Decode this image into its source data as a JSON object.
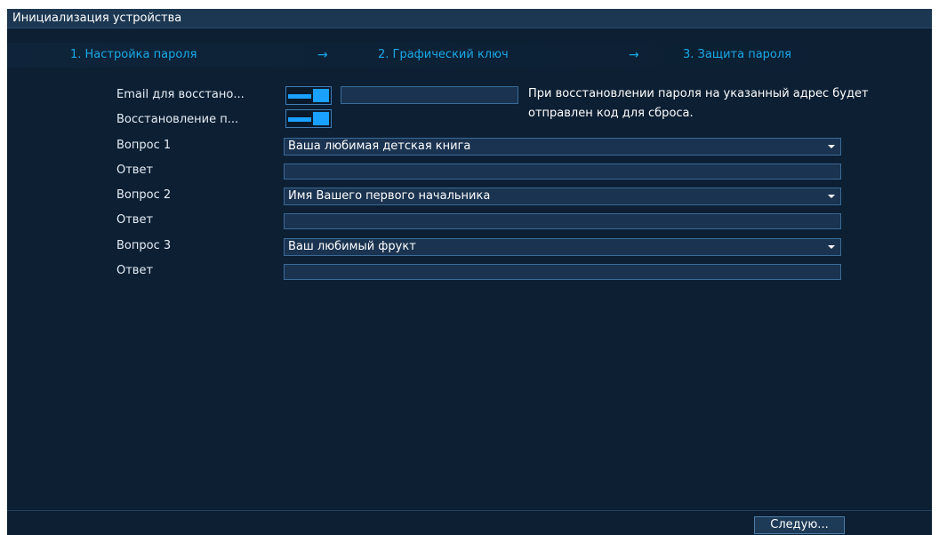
{
  "window": {
    "title": "Инициализация устройства"
  },
  "steps": {
    "step1": "1.  Настройка пароля",
    "step2": "2.  Графический ключ",
    "step3": "3.  Защита пароля",
    "arrow": "→",
    "active_color": "#1aa8e6"
  },
  "form": {
    "email_label": "Email для восстано...",
    "email_toggle": "on",
    "email_value": "",
    "recovery_label": "Восстановление п...",
    "recovery_toggle": "on",
    "hint": "При восстановлении пароля на указанный адрес будет отправлен код для сброса.",
    "questions": [
      {
        "label": "Вопрос 1",
        "value": "Ваша любимая детская книга",
        "answer_label": "Ответ",
        "answer": ""
      },
      {
        "label": "Вопрос 2",
        "value": "Имя Вашего первого начальника",
        "answer_label": "Ответ",
        "answer": ""
      },
      {
        "label": "Вопрос 3",
        "value": "Ваш любимый фрукт",
        "answer_label": "Ответ",
        "answer": ""
      }
    ]
  },
  "footer": {
    "next_label": "Следую..."
  },
  "colors": {
    "background": "#0c1f33",
    "accent": "#1aa0ff",
    "field": "#1a3350"
  }
}
